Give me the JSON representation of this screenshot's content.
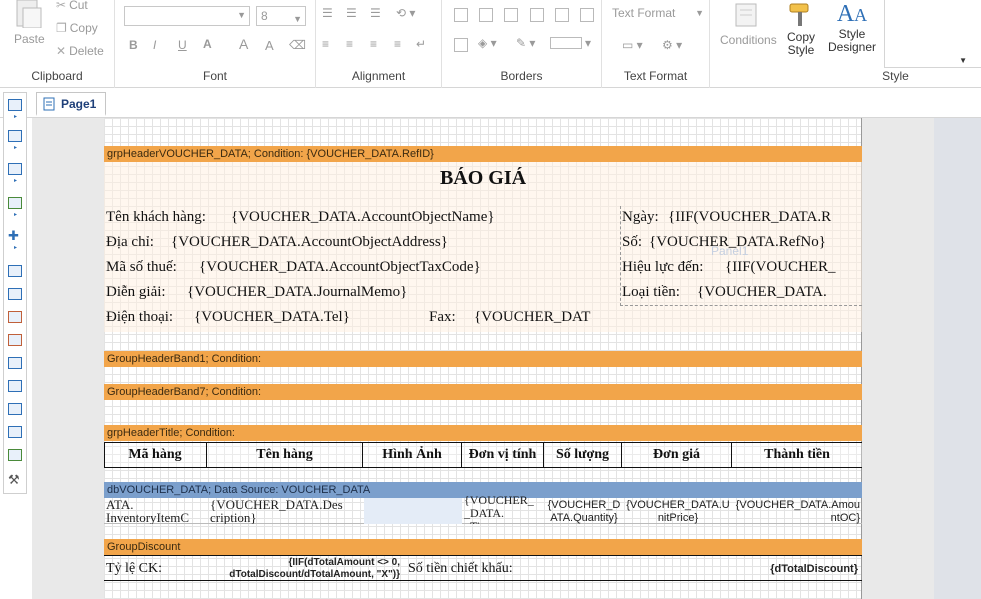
{
  "ribbon": {
    "clipboard": {
      "label": "Clipboard",
      "paste": "Paste",
      "cut": "Cut",
      "copy": "Copy",
      "delete": "Delete"
    },
    "font": {
      "label": "Font",
      "font_name": "",
      "font_size": "8",
      "bold": "B",
      "italic": "I",
      "underline": "U",
      "font_color": "A",
      "grow": "A",
      "shrink": "A"
    },
    "alignment": {
      "label": "Alignment"
    },
    "borders": {
      "label": "Borders"
    },
    "text_format": {
      "label": "Text Format",
      "value": "Text Format"
    },
    "style": {
      "label": "Style",
      "conditions": "Conditions",
      "copy_style": "Copy\nStyle",
      "style_designer": "Style\nDesigner"
    }
  },
  "tabs": [
    {
      "label": "Page1"
    }
  ],
  "report": {
    "band_header_voucher": "grpHeaderVOUCHER_DATA;  Condition:  {VOUCHER_DATA.RefID}",
    "title": "BÁO GIÁ",
    "left_rows": [
      {
        "label": "Tên khách hàng:",
        "value": "{VOUCHER_DATA.AccountObjectName}"
      },
      {
        "label": "Địa chỉ:",
        "value": "{VOUCHER_DATA.AccountObjectAddress}"
      },
      {
        "label": "Mã số thuế:",
        "value": "{VOUCHER_DATA.AccountObjectTaxCode}"
      },
      {
        "label": "Diễn giải:",
        "value": "{VOUCHER_DATA.JournalMemo}"
      },
      {
        "label": "Điện thoại:",
        "value": "{VOUCHER_DATA.Tel}"
      }
    ],
    "fax_label": "Fax:",
    "fax_value": "{VOUCHER_DAT",
    "right_rows": [
      {
        "label": "Ngày:",
        "value": "{IIF(VOUCHER_DATA.R"
      },
      {
        "label": "Số:",
        "value": "{VOUCHER_DATA.RefNo}"
      },
      {
        "label": "Hiệu lực đến:",
        "value": "{IIF(VOUCHER_"
      },
      {
        "label": "Loại tiền:",
        "value": "{VOUCHER_DATA."
      }
    ],
    "watermark": "Panel1",
    "band_group1": "GroupHeaderBand1; Condition:",
    "band_group7": "GroupHeaderBand7; Condition:",
    "band_title": "grpHeaderTitle; Condition:",
    "table_headers": [
      "Mã hàng",
      "Tên hàng",
      "Hình Ảnh",
      "Đơn vị tính",
      "Số lượng",
      "Đơn giá",
      "Thành tiền"
    ],
    "band_detail": "dbVOUCHER_DATA;  Data  Source:  VOUCHER_DATA",
    "detail_cells": [
      "ATA.\nInventoryItemC",
      "{VOUCHER_DATA.Des\ncription}",
      "",
      "{VOUCHER_\n_DATA.\n_Ti...",
      "{VOUCHER_D\nATA.Quantity}",
      "{VOUCHER_DATA.U\nnitPrice}",
      "{VOUCHER_DATA.Amou\nntOC}"
    ],
    "band_discount": "GroupDiscount",
    "discount_rate_label": "Tỷ lệ CK:",
    "discount_formula": "{IIF(dTotalAmount <> 0,\ndTotalDiscount/dTotalAmount, \"X\")}",
    "discount_amount_label": "Số tiền chiết khấu:",
    "discount_amount_value": "{dTotalDiscount}"
  },
  "colors": {
    "band_orange": "#f2a54a",
    "band_blue": "#7b9fcc",
    "accent": "#2e6fb6"
  }
}
